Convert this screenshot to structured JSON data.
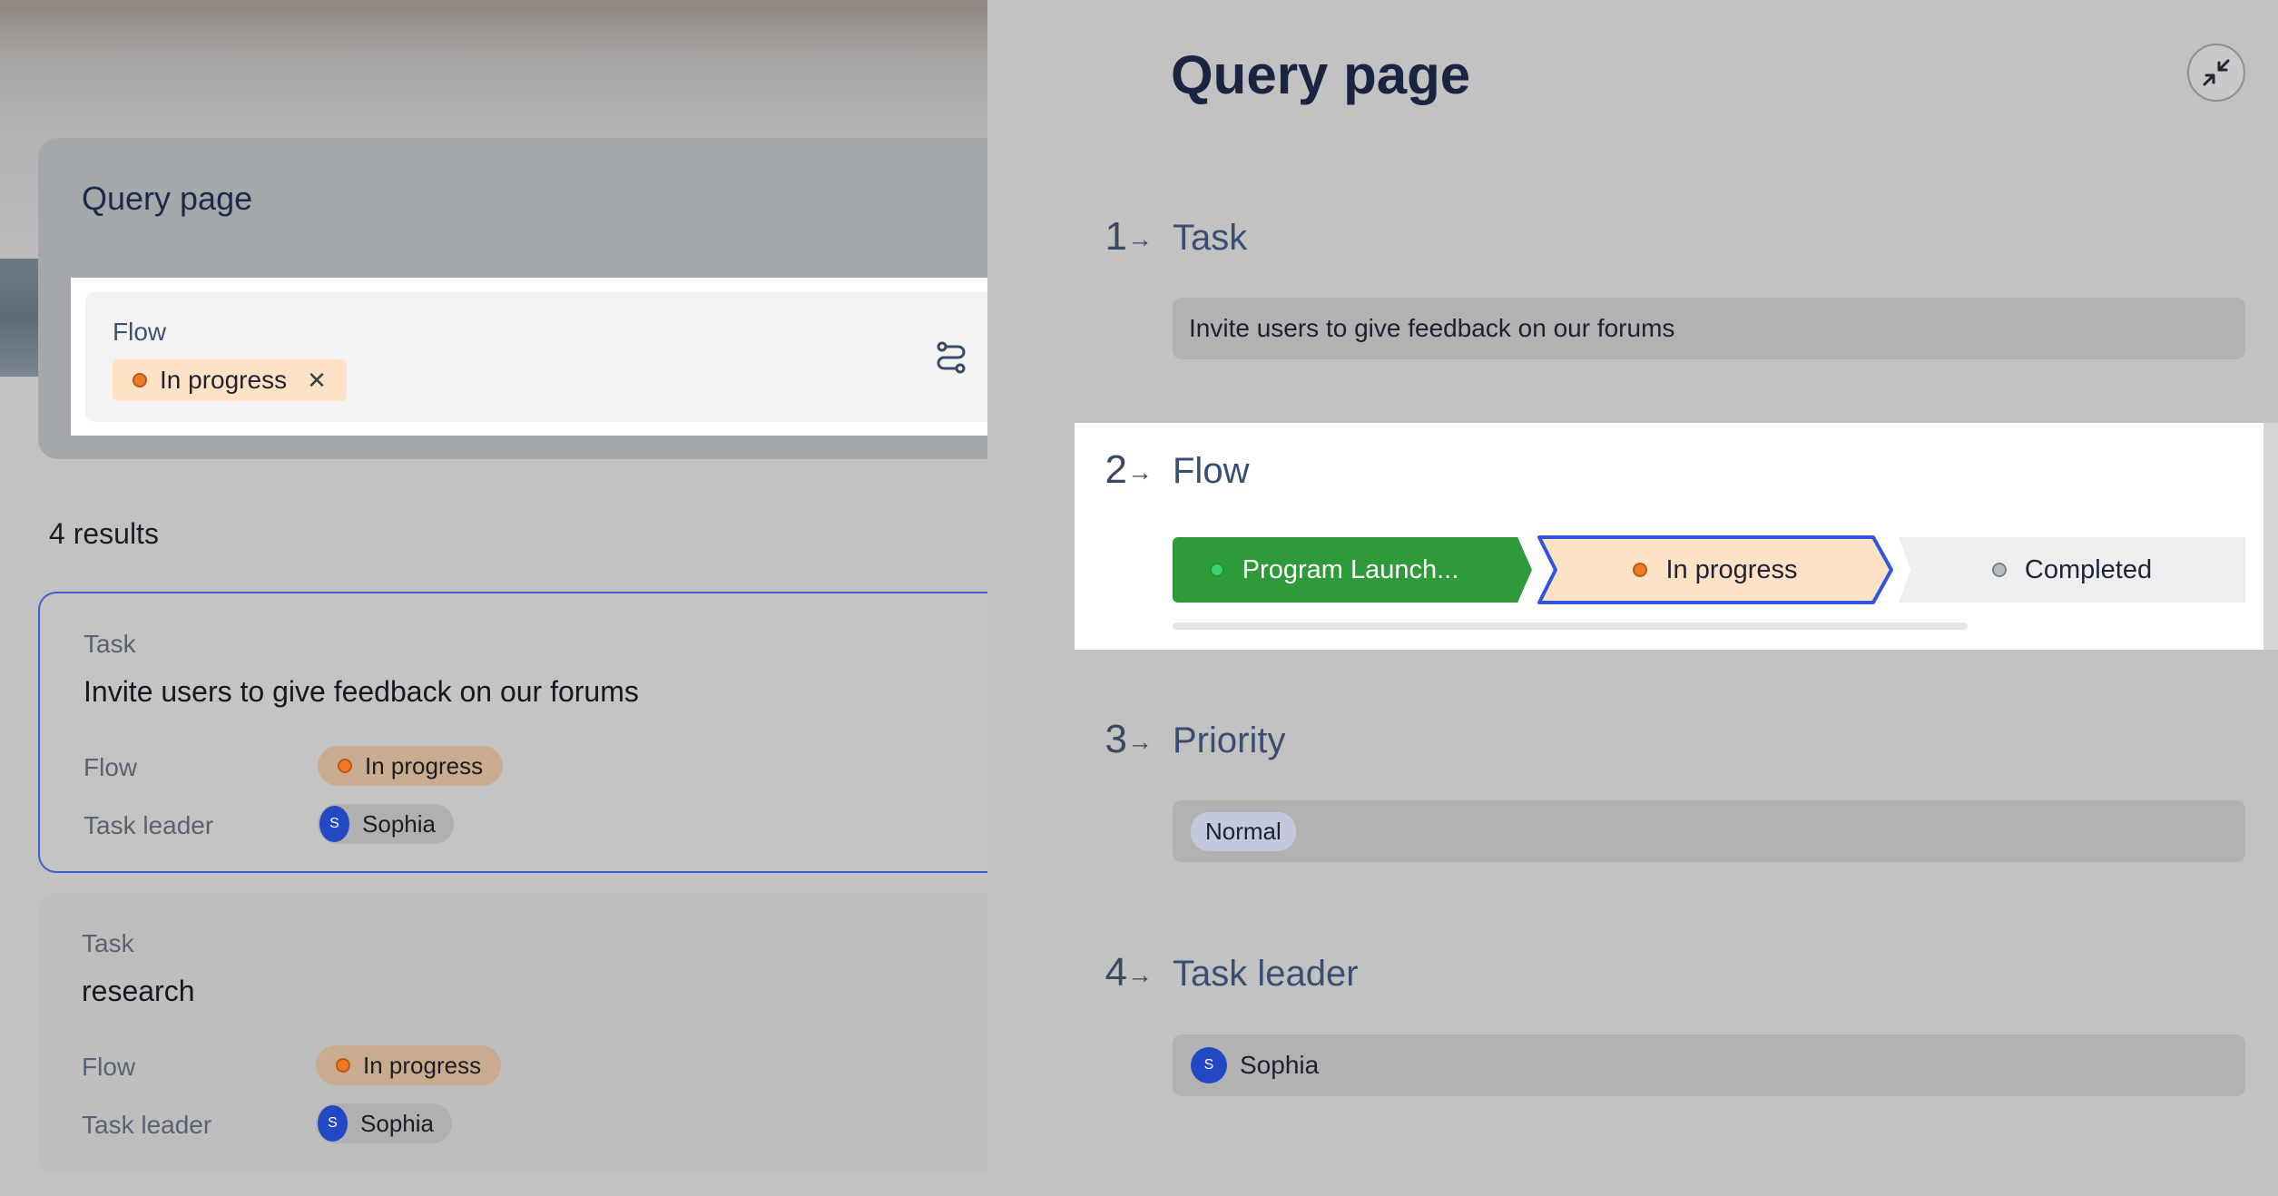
{
  "left": {
    "query_title": "Query page",
    "filter": {
      "label": "Flow",
      "chip_text": "In progress",
      "chip_close": "✕"
    },
    "results_count": "4 results",
    "cards": [
      {
        "kicker": "Task",
        "title": "Invite users to give feedback on our forums",
        "flow_label": "Flow",
        "flow_value": "In progress",
        "leader_label": "Task leader",
        "leader_initial": "S",
        "leader_name": "Sophia"
      },
      {
        "kicker": "Task",
        "title": "research",
        "flow_label": "Flow",
        "flow_value": "In progress",
        "leader_label": "Task leader",
        "leader_initial": "S",
        "leader_name": "Sophia"
      }
    ]
  },
  "panel": {
    "title": "Query page",
    "sections": [
      {
        "number": "1",
        "arrow": "→",
        "label": "Task",
        "value": "Invite users to give feedback on our forums"
      },
      {
        "number": "2",
        "arrow": "→",
        "label": "Flow"
      },
      {
        "number": "3",
        "arrow": "→",
        "label": "Priority",
        "value": "Normal"
      },
      {
        "number": "4",
        "arrow": "→",
        "label": "Task leader",
        "value": "Sophia",
        "initial": "S"
      }
    ],
    "flow_stages": [
      {
        "label": "Program Launch...",
        "state": "done"
      },
      {
        "label": "In progress",
        "state": "current"
      },
      {
        "label": "Completed",
        "state": "pending"
      }
    ]
  },
  "colors": {
    "accent_blue": "#2348c4",
    "stage_green": "#2e9a3a",
    "stage_current": "#fde2c6",
    "in_progress_dot": "#ef7a26"
  }
}
